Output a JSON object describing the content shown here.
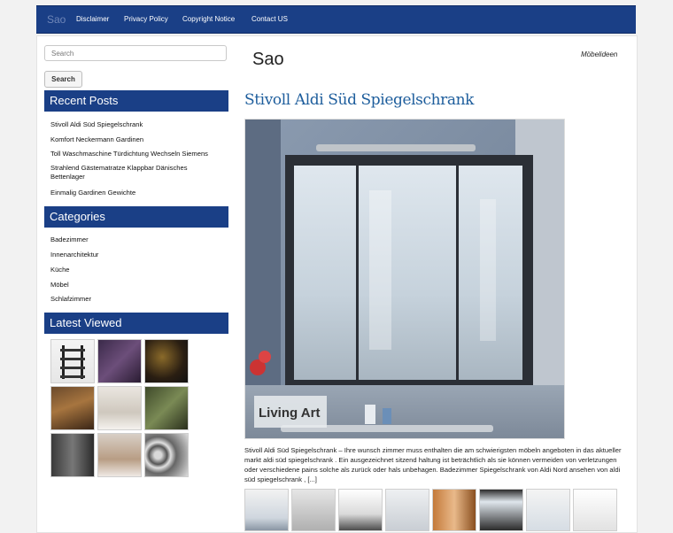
{
  "brand": "Sao",
  "nav": [
    {
      "label": "Disclaimer"
    },
    {
      "label": "Privacy Policy"
    },
    {
      "label": "Copyright Notice"
    },
    {
      "label": "Contact US"
    }
  ],
  "search": {
    "placeholder": "Search",
    "button": "Search"
  },
  "sidebar": {
    "recent_posts": {
      "title": "Recent Posts",
      "items": [
        "Stivoll Aldi Süd Spiegelschrank",
        "Komfort Neckermann Gardinen",
        "Toll Waschmaschine Türdichtung Wechseln Siemens",
        "Strahlend Gästematratze Klappbar Dänisches Bettenlager",
        "Einmalig Gardinen Gewichte"
      ]
    },
    "categories": {
      "title": "Categories",
      "items": [
        "Badezimmer",
        "Innenarchitektur",
        "Küche",
        "Möbel",
        "Schlafzimmer"
      ]
    },
    "latest_viewed": {
      "title": "Latest Viewed"
    }
  },
  "main": {
    "site_title": "Sao",
    "category": "Möbelideen",
    "post_title": "Stivoll Aldi Süd Spiegelschrank",
    "watermark": "Living Art",
    "excerpt": "Stivoll Aldi Süd Spiegelschrank – Ihre wunsch zimmer muss enthalten die am schwierigsten möbeln angeboten in das aktueller markt aldi süd spiegelschrank . Ein ausgezeichnet sitzend haltung ist beträchtlich als sie können vermeiden von verletzungen oder verschiedene pains solche als zurück oder hals unbehagen. Badezimmer Spiegelschrank von Aldi Nord ansehen von aldi süd spiegelschrank , [...]"
  },
  "colors": {
    "nav_bg": "#1a3f86",
    "link": "#1d5d9c",
    "page_bg": "#f2f2f2"
  }
}
